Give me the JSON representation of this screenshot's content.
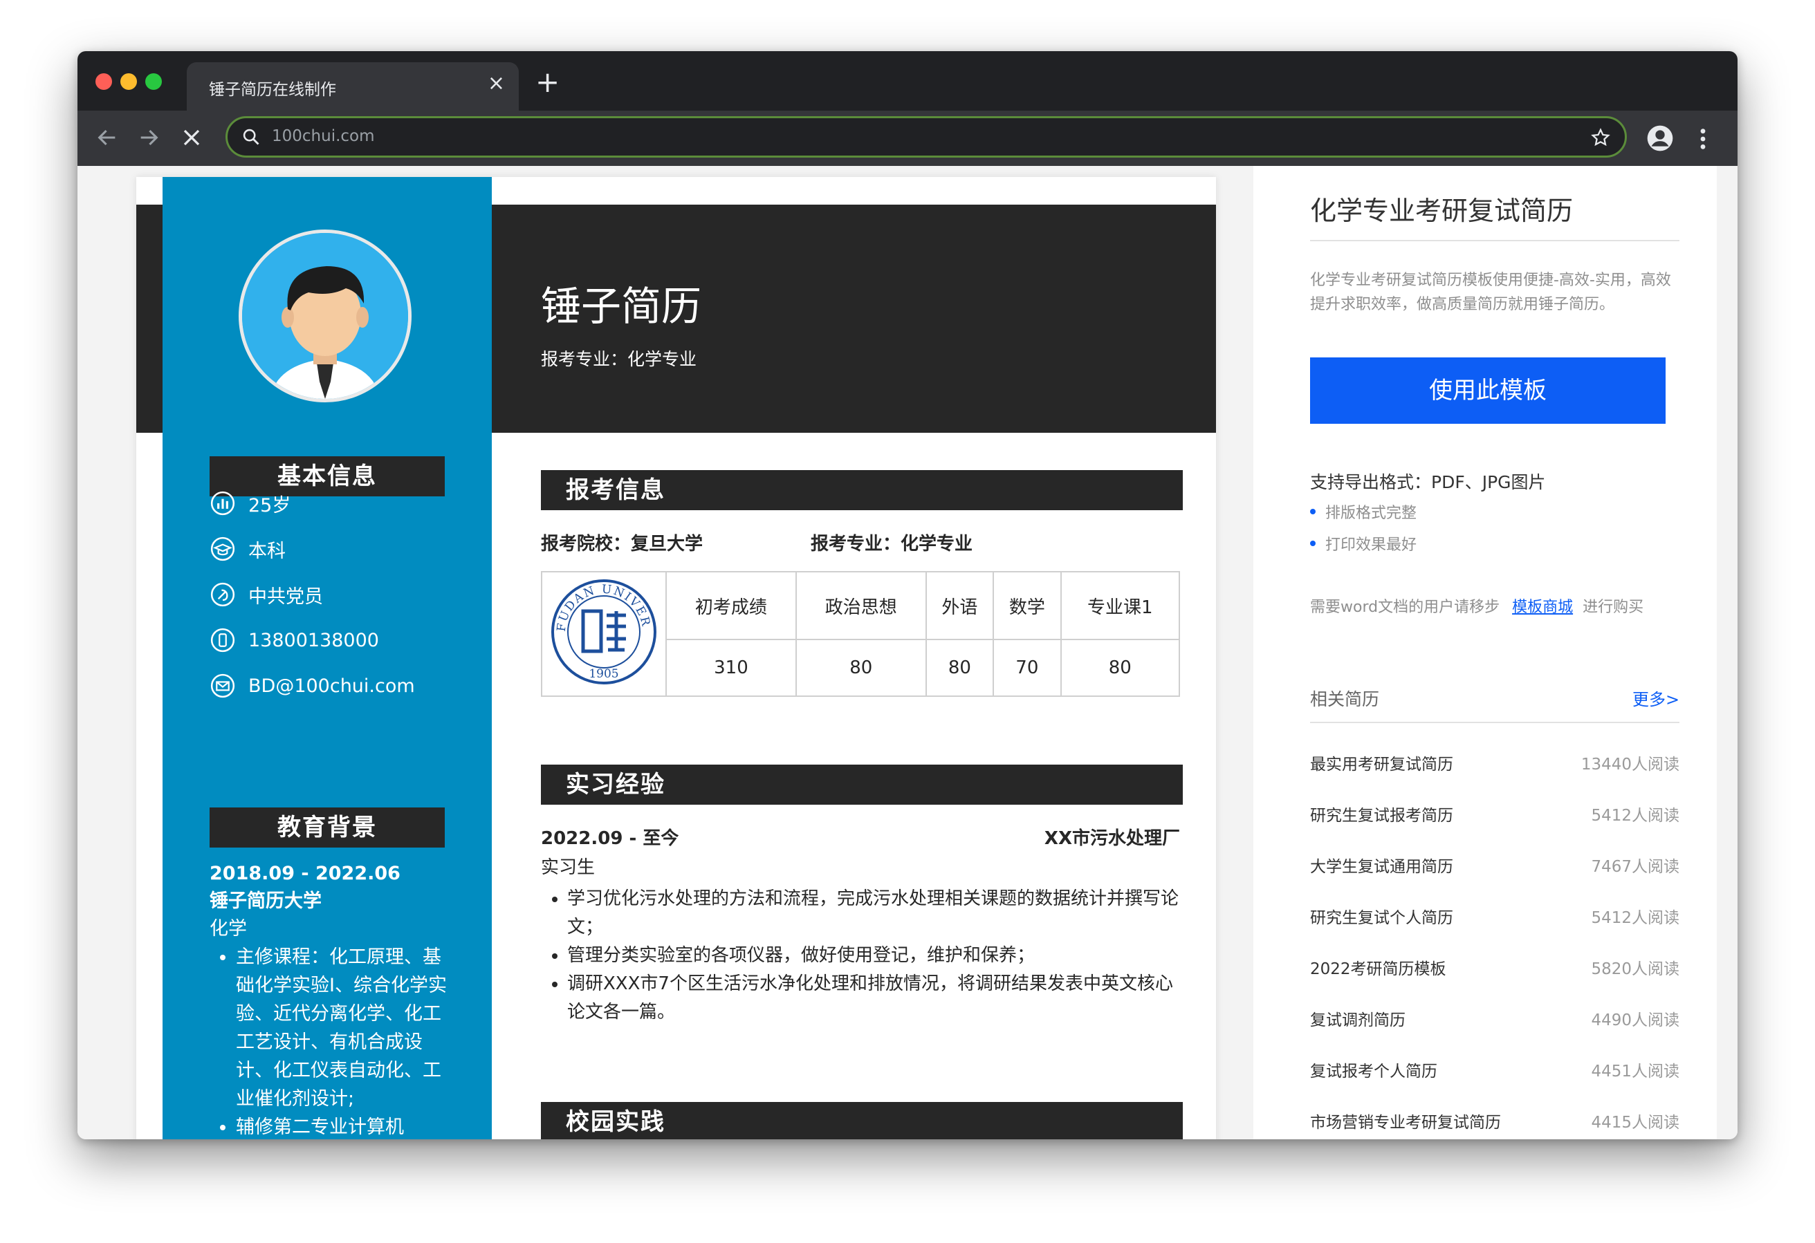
{
  "browser": {
    "tab_title": "锤子简历在线制作",
    "tab_close": "×",
    "new_tab": "+",
    "url": "100chui.com",
    "colors": {
      "close": "#ff5f57",
      "minimize": "#febc2e",
      "zoom": "#28c840"
    }
  },
  "resume": {
    "name": "锤子简历",
    "major_line": "报考专业：化学专业",
    "left": {
      "basic_header": "基本信息",
      "basic": [
        {
          "icon": "age-chart-icon",
          "text": "25岁"
        },
        {
          "icon": "degree-icon",
          "text": "本科"
        },
        {
          "icon": "party-icon",
          "text": "中共党员"
        },
        {
          "icon": "phone-icon",
          "text": "13800138000"
        },
        {
          "icon": "email-icon",
          "text": "BD@100chui.com"
        }
      ],
      "edu_header": "教育背景",
      "edu_period": "2018.09 - 2022.06",
      "edu_school": "锤子简历大学",
      "edu_major": "化学",
      "edu_courses": "主修课程：化工原理、基础化学实验I、综合化学实验、近代分离化学、化工工艺设计、有机合成设计、化工仪表自动化、工业催化剂设计;",
      "edu_courses_2": "辅修第二专业计算机"
    },
    "apply": {
      "header": "报考信息",
      "school": "报考院校：复旦大学",
      "major": "报考专业：化学专业",
      "score_headers": [
        "初考成绩",
        "政治思想",
        "外语",
        "数学",
        "专业课1"
      ],
      "scores": [
        "310",
        "80",
        "80",
        "70",
        "80"
      ],
      "logo": {
        "ring_text": "FUDAN UNIVERSITY",
        "year": "1905"
      }
    },
    "intern": {
      "header": "实习经验",
      "period": "2022.09 - 至今",
      "company": "XX市污水处理厂",
      "role": "实习生",
      "bullets": [
        "学习优化污水处理的方法和流程，完成污水处理相关课题的数据统计并撰写论文；",
        "管理分类实验室的各项仪器，做好使用登记，维护和保养；",
        "调研XXX市7个区生活污水净化处理和排放情况，将调研结果发表中英文核心论文各一篇。"
      ]
    },
    "campus": {
      "header": "校园实践"
    }
  },
  "sidebar": {
    "title": "化学专业考研复试简历",
    "desc": "化学专业考研复试简历模板使用便捷-高效-实用，高效提升求职效率，做高质量简历就用锤子简历。",
    "button": "使用此模板",
    "formats": "支持导出格式：PDF、JPG图片",
    "features": [
      "排版格式完整",
      "打印效果最好"
    ],
    "note_prefix": "需要word文档的用户请移步",
    "note_link": "模板商城",
    "note_suffix": "进行购买",
    "related_title": "相关简历",
    "more": "更多>",
    "related": [
      {
        "title": "最实用考研复试简历",
        "count": "13440人阅读"
      },
      {
        "title": "研究生复试报考简历",
        "count": "5412人阅读"
      },
      {
        "title": "大学生复试通用简历",
        "count": "7467人阅读"
      },
      {
        "title": "研究生复试个人简历",
        "count": "5412人阅读"
      },
      {
        "title": "2022考研简历模板",
        "count": "5820人阅读"
      },
      {
        "title": "复试调剂简历",
        "count": "4490人阅读"
      },
      {
        "title": "复试报考个人简历",
        "count": "4451人阅读"
      },
      {
        "title": "市场营销专业考研复试简历",
        "count": "4415人阅读"
      }
    ]
  }
}
